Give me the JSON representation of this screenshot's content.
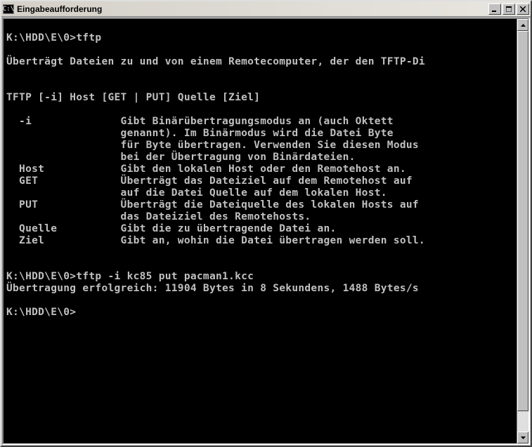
{
  "window": {
    "title": "Eingabeaufforderung",
    "icon_label": "cmd-icon"
  },
  "terminal": {
    "lines": {
      "l0": "",
      "l1_prompt": "K:\\HDD\\E\\0>",
      "l1_cmd": "tftp",
      "l2": "",
      "l3": "Überträgt Dateien zu und von einem Remotecomputer, der den TFTP-Di",
      "l4": "",
      "l5": "",
      "l6": "TFTP [-i] Host [GET | PUT] Quelle [Ziel]",
      "l7": "",
      "l8": "  -i              Gibt Binärübertragungsmodus an (auch Oktett",
      "l9": "                  genannt). Im Binärmodus wird die Datei Byte",
      "l10": "                  für Byte übertragen. Verwenden Sie diesen Modus",
      "l11": "                  bei der Übertragung von Binärdateien.",
      "l12": "  Host            Gibt den lokalen Host oder den Remotehost an.",
      "l13": "  GET             Überträgt das Dateiziel auf dem Remotehost auf",
      "l14": "                  auf die Datei Quelle auf dem lokalen Host.",
      "l15": "  PUT             Überträgt die Dateiquelle des lokalen Hosts auf",
      "l16": "                  das Dateiziel des Remotehosts.",
      "l17": "  Quelle          Gibt die zu übertragende Datei an.",
      "l18": "  Ziel            Gibt an, wohin die Datei übertragen werden soll.",
      "l19": "",
      "l20": "",
      "l21_prompt": "K:\\HDD\\E\\0>",
      "l21_cmd": "tftp -i kc85 put pacman1.kcc",
      "l22": "Übertragung erfolgreich: 11904 Bytes in 8 Sekundens, 1488 Bytes/s",
      "l23": "",
      "l24_prompt": "K:\\HDD\\E\\0>",
      "l24_cmd": ""
    }
  }
}
